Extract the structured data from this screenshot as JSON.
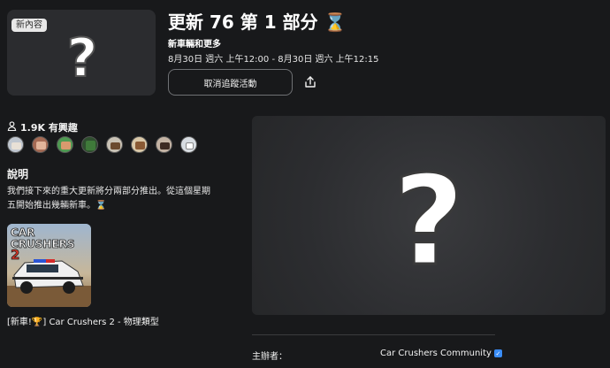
{
  "event": {
    "badge": "新內容",
    "title": "更新 76 第 1 部分 ⌛",
    "subtitle": "新車輛和更多",
    "dates": "8月30日 週六 上午12:00 - 8月30日 週六 上午12:15",
    "cancel_button": "取消追蹤活動",
    "share_icon": "share-icon"
  },
  "interest": {
    "count_label": "1.9K 有興趣",
    "avatars": [
      "avatar-1",
      "avatar-2",
      "avatar-3",
      "avatar-4",
      "avatar-5",
      "avatar-6",
      "avatar-7",
      "avatar-8"
    ]
  },
  "description": {
    "heading": "說明",
    "text": "我們接下來的重大更新將分兩部分推出。從這個星期五開始推出幾輛新車。⌛"
  },
  "game": {
    "logo_text": "CAR CRUSHERS 2",
    "label": "[新車!🏆] Car Crushers 2 - 物理類型"
  },
  "host": {
    "label": "主辦者：",
    "name": "Car Crushers Community"
  },
  "colors": {
    "background": "#18191b",
    "verify": "#3a8df7"
  }
}
